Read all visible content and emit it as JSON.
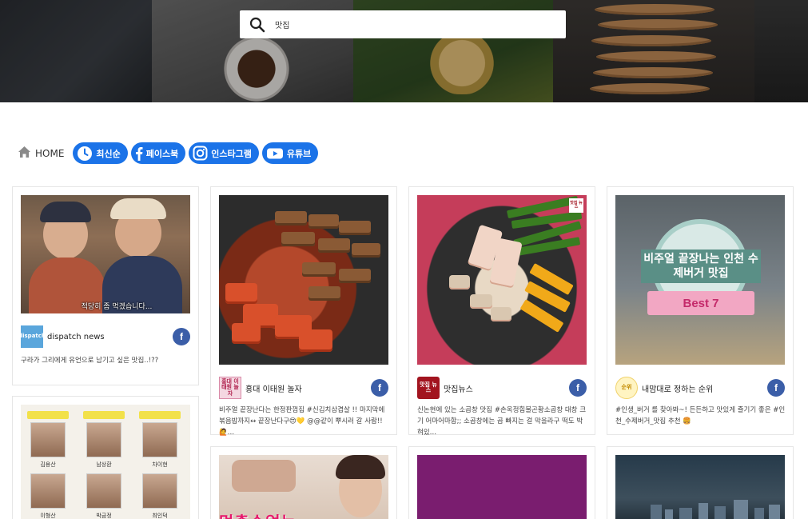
{
  "search": {
    "value": "맛집"
  },
  "nav": {
    "home_label": "HOME",
    "pills": [
      {
        "label": "최신순",
        "icon": "clock-icon"
      },
      {
        "label": "페이스북",
        "icon": "facebook-icon"
      },
      {
        "label": "인스타그램",
        "icon": "instagram-icon"
      },
      {
        "label": "유튜브",
        "icon": "youtube-icon"
      }
    ]
  },
  "cards": [
    {
      "source": "dispatch news",
      "logo_text": "dispatch",
      "caption_overlay": "적당히 좀 먹겠습니다...",
      "description": "구라가 그리에게 유언으로 남기고 싶은 맛집..!??",
      "social": "f"
    },
    {
      "source": "홍대 이태원 놀자",
      "logo_text": "홍대 이태원 놀자",
      "description": "비주얼 끝장난다는 한정판껍집 #신김치삼겹살 !! 마지막에 볶음밥까지↔ 끝장난다구😍💛 @@같이 뿌시러 갈 사람!!🙋…",
      "social": "f"
    },
    {
      "source": "맛집뉴스",
      "logo_text": "맛집 뉴스",
      "thumb_badge": "맛집 뉴스",
      "description": "신논현에 있는 소곱창 맛집 #손옥정힘불곤황소곱창 대창 크기 어마어마함;; 소곱창에는 곱 빠지는 걸 막을라구 떡도 박혀있…",
      "social": "f"
    },
    {
      "source": "내맘대로 정하는 순위",
      "logo_text": "순위",
      "badge_title": "비주얼 끝장나는 인천 수제버거 맛집",
      "best_label": "Best 7",
      "description": "#인생_버거 를 찾아봐~! 든든하고 맛있게 즐기기 좋은 #인천_수제버거_맛집 추천 🍔",
      "social": "f"
    },
    {
      "grid_names": [
        "김용산",
        "남상환",
        "차이현",
        "이형산",
        "박금정",
        "최인덕"
      ]
    },
    {
      "banner_text": "먹출수없는"
    },
    {},
    {}
  ]
}
